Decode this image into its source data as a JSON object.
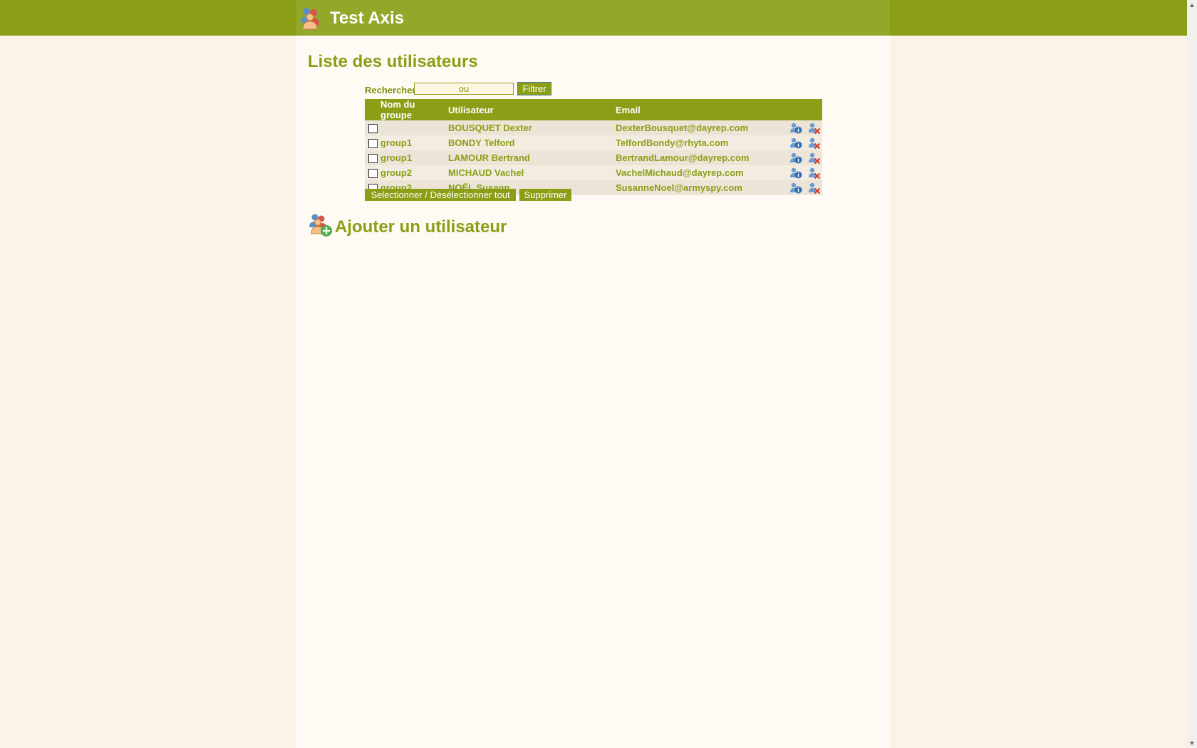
{
  "header": {
    "title": "Test Axis",
    "logo_icon": "users-icon"
  },
  "page_title": "Liste des utilisateurs",
  "search": {
    "label": "Rechercher:",
    "value": "ou",
    "button": "Filtrer"
  },
  "table": {
    "columns": [
      "Nom du groupe",
      "Utilisateur",
      "Email"
    ],
    "rows": [
      {
        "group": "",
        "user": "BOUSQUET Dexter",
        "email": "DexterBousquet@dayrep.com"
      },
      {
        "group": "group1",
        "user": "BONDY Telford",
        "email": "TelfordBondy@rhyta.com"
      },
      {
        "group": "group1",
        "user": "LAMOUR Bertrand",
        "email": "BertrandLamour@dayrep.com"
      },
      {
        "group": "group2",
        "user": "MICHAUD Vachel",
        "email": "VachelMichaud@dayrep.com"
      },
      {
        "group": "group2",
        "user": "NOËL Susann",
        "email": "SusanneNoel@armyspy.com"
      }
    ],
    "row_actions": [
      "user-info-icon",
      "user-delete-icon"
    ]
  },
  "actions": {
    "select_all": "Selectionner / Désélectionner tout",
    "delete": "Supprimer"
  },
  "add_user": {
    "title": "Ajouter un utilisateur",
    "icon": "add-user-icon"
  },
  "colors": {
    "brand": "#8b9e16",
    "header": "#93a82b",
    "background": "#fbf3e7",
    "content": "#fffaf3"
  }
}
